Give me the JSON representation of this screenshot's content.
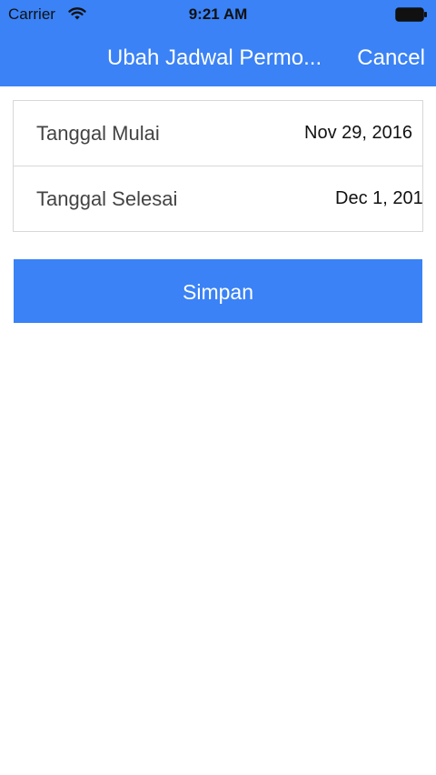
{
  "status_bar": {
    "carrier": "Carrier",
    "time": "9:21 AM",
    "signal_icon": "wifi-icon",
    "battery_icon": "battery-icon"
  },
  "nav": {
    "title": "Ubah Jadwal Permo...",
    "cancel_label": "Cancel"
  },
  "form": {
    "start_label": "Tanggal Mulai",
    "start_value": "Nov 29, 2016",
    "end_label": "Tanggal Selesai",
    "end_value": "Dec 1, 201"
  },
  "actions": {
    "save_label": "Simpan"
  },
  "colors": {
    "primary": "#3a82f6",
    "background": "#ffffff",
    "border": "#d8d8d8"
  }
}
